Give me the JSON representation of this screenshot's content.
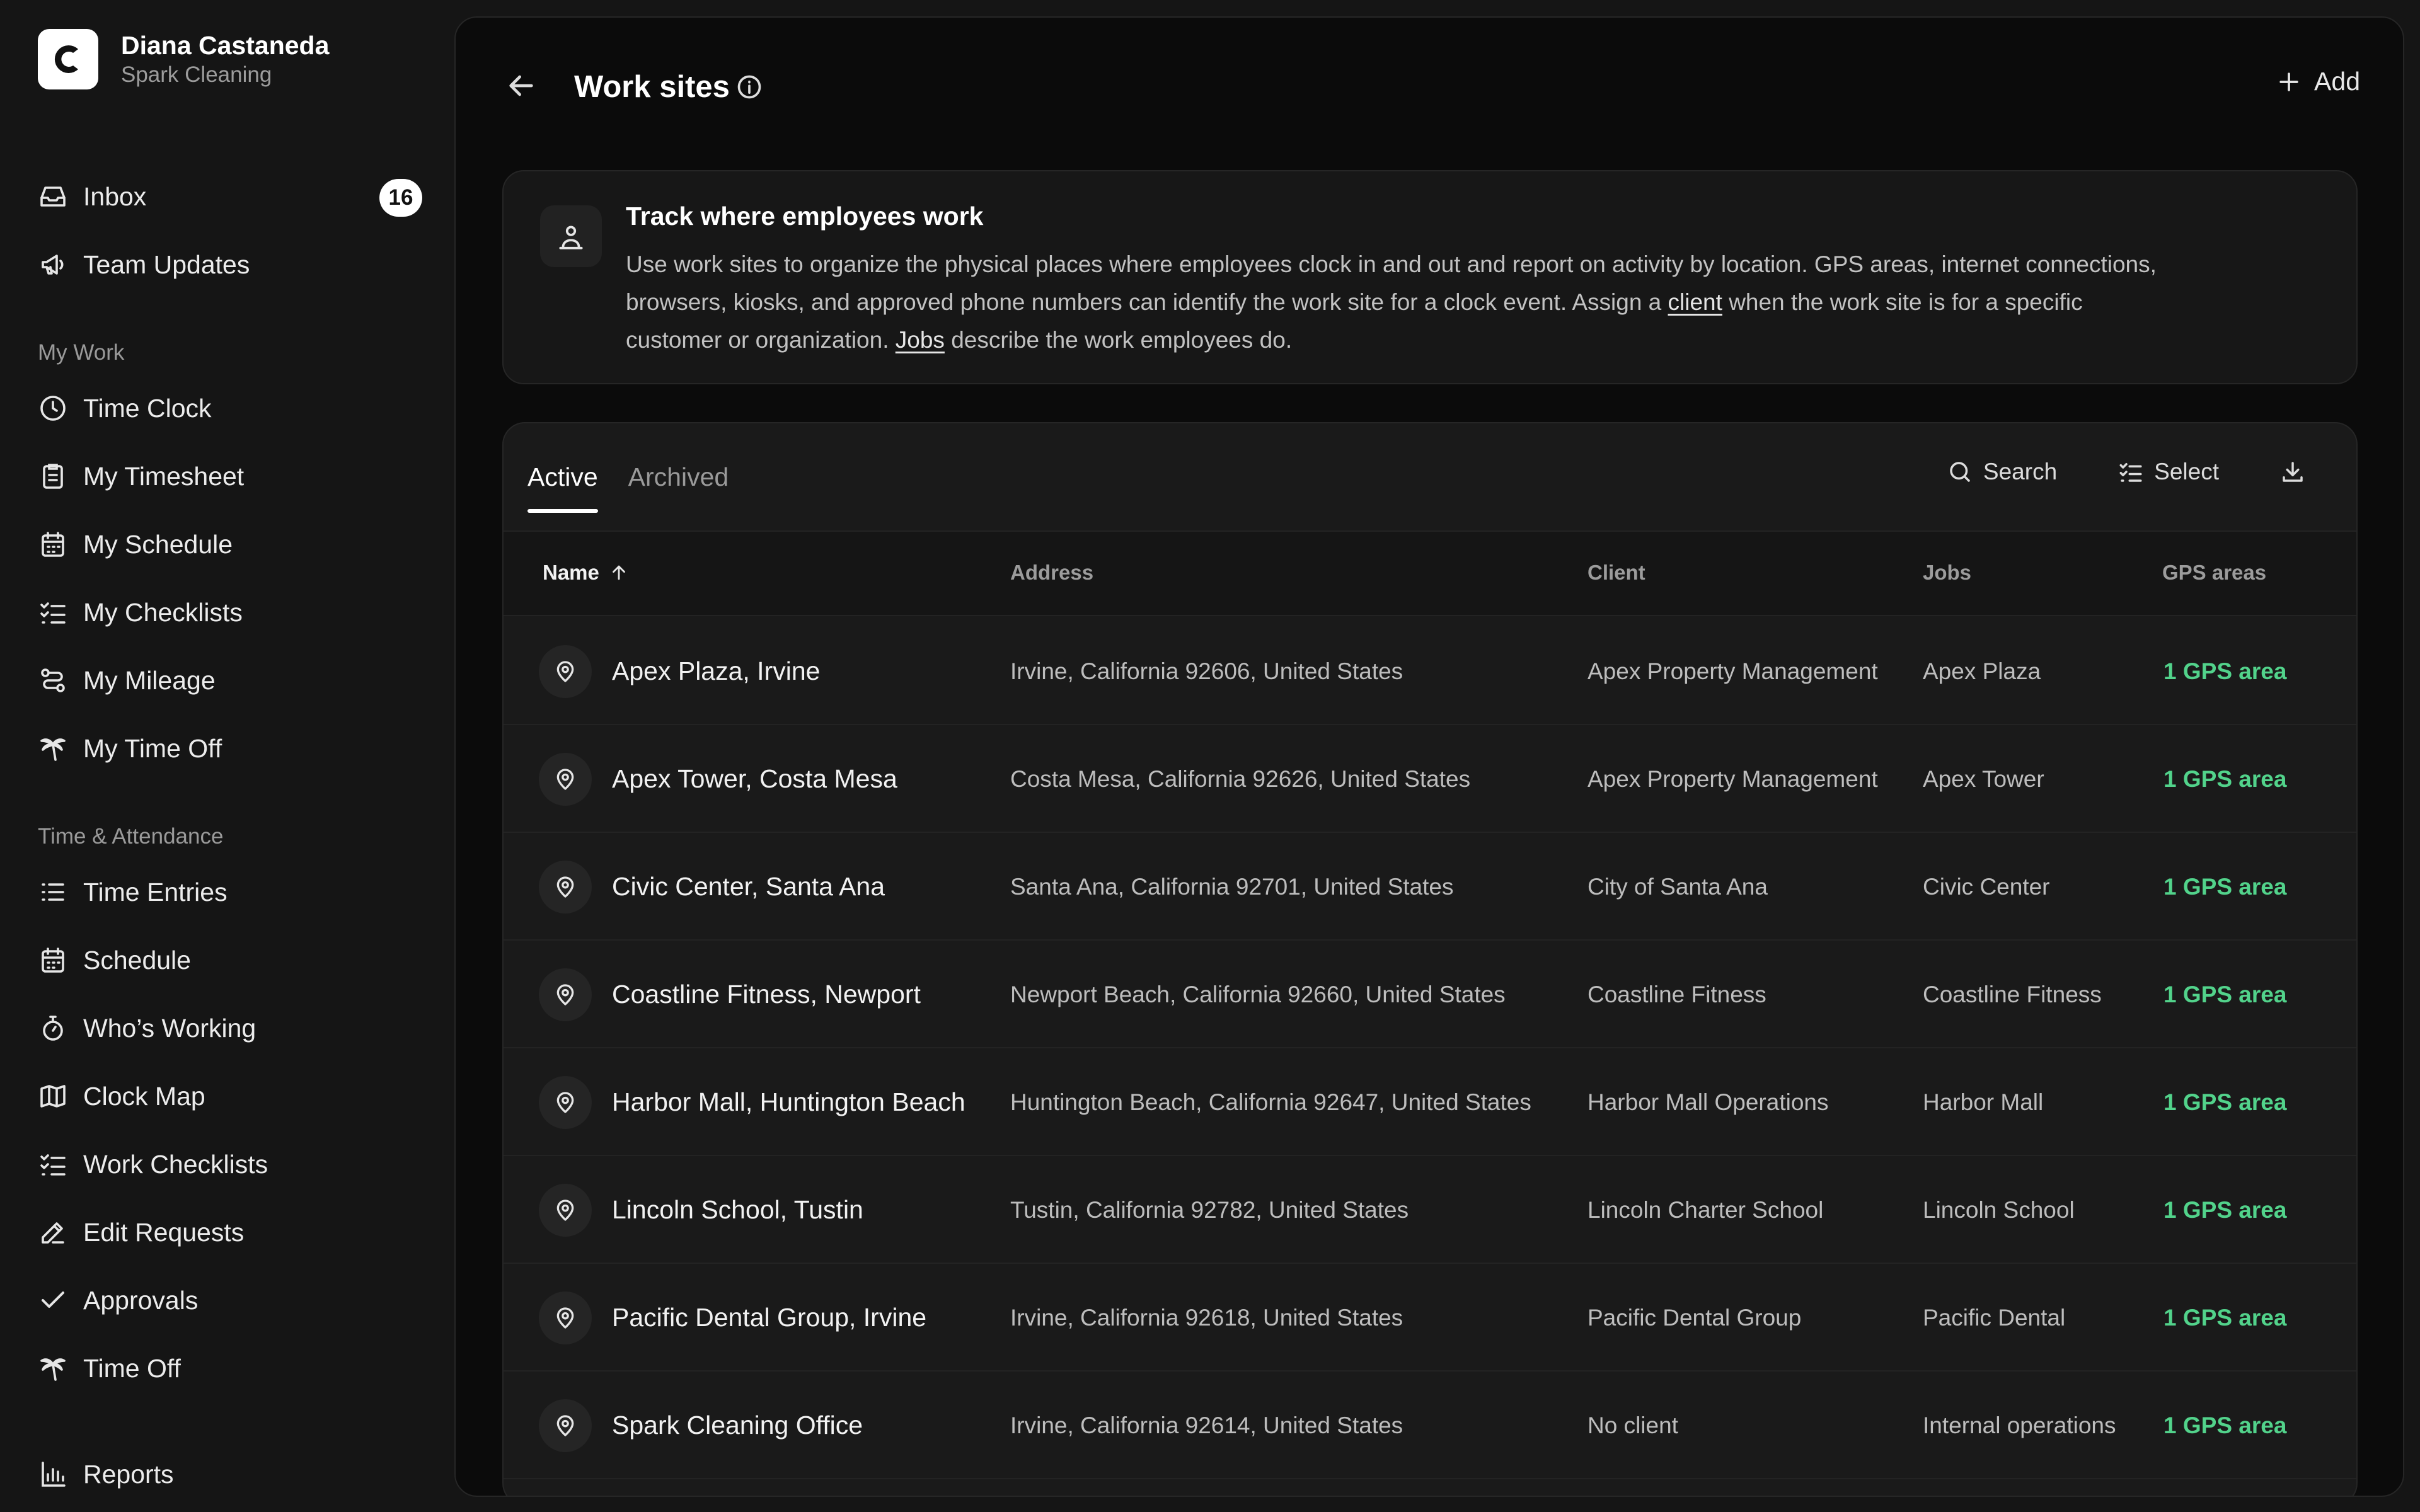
{
  "org": {
    "name": "Diana Castaneda",
    "company": "Spark Cleaning",
    "logo_letter": "C"
  },
  "sidebar": {
    "top": [
      {
        "label": "Inbox",
        "icon": "inbox-icon",
        "badge": "16"
      },
      {
        "label": "Team Updates",
        "icon": "megaphone-icon"
      }
    ],
    "section_my_work": "My Work",
    "my_work": [
      {
        "label": "Time Clock",
        "icon": "clock-icon"
      },
      {
        "label": "My Timesheet",
        "icon": "clipboard-icon"
      },
      {
        "label": "My Schedule",
        "icon": "calendar-icon"
      },
      {
        "label": "My Checklists",
        "icon": "checklist-icon"
      },
      {
        "label": "My Mileage",
        "icon": "route-icon"
      },
      {
        "label": "My Time Off",
        "icon": "palm-tree-icon"
      }
    ],
    "section_time": "Time & Attendance",
    "time": [
      {
        "label": "Time Entries",
        "icon": "list-icon"
      },
      {
        "label": "Schedule",
        "icon": "calendar-icon"
      },
      {
        "label": "Who’s Working",
        "icon": "stopwatch-icon"
      },
      {
        "label": "Clock Map",
        "icon": "map-icon"
      },
      {
        "label": "Work Checklists",
        "icon": "checklist-icon"
      },
      {
        "label": "Edit Requests",
        "icon": "pencil-icon"
      },
      {
        "label": "Approvals",
        "icon": "check-icon"
      },
      {
        "label": "Time Off",
        "icon": "palm-tree-icon"
      }
    ],
    "reports": {
      "label": "Reports",
      "icon": "bar-chart-icon"
    }
  },
  "header": {
    "title": "Work sites",
    "add_label": "Add"
  },
  "callout": {
    "title": "Track where employees work",
    "body_1": "Use work sites to organize the physical places where employees clock in and out and report on activity by location. GPS areas, internet connections, browsers, kiosks, and approved phone numbers can identify the work site for a clock event. Assign a",
    "link_client": "client",
    "body_2": "when the work site is for a specific customer or organization.",
    "link_jobs": "Jobs",
    "body_3": "describe the work employees do."
  },
  "tabs": [
    {
      "label": "Active",
      "active": true
    },
    {
      "label": "Archived",
      "active": false
    }
  ],
  "toolbar": {
    "search_label": "Search",
    "select_label": "Select"
  },
  "table": {
    "columns": {
      "name": "Name",
      "address": "Address",
      "client": "Client",
      "jobs": "Jobs",
      "gps": "GPS areas"
    },
    "rows": [
      {
        "name": "Apex Plaza, Irvine",
        "address": "Irvine, California 92606, United States",
        "client": "Apex Property Management",
        "jobs": "Apex Plaza",
        "gps": "1 GPS area"
      },
      {
        "name": "Apex Tower, Costa Mesa",
        "address": "Costa Mesa, California 92626, United States",
        "client": "Apex Property Management",
        "jobs": "Apex Tower",
        "gps": "1 GPS area"
      },
      {
        "name": "Civic Center, Santa Ana",
        "address": "Santa Ana, California 92701, United States",
        "client": "City of Santa Ana",
        "jobs": "Civic Center",
        "gps": "1 GPS area"
      },
      {
        "name": "Coastline Fitness, Newport",
        "address": "Newport Beach, California 92660, United States",
        "client": "Coastline Fitness",
        "jobs": "Coastline Fitness",
        "gps": "1 GPS area"
      },
      {
        "name": "Harbor Mall, Huntington Beach",
        "address": "Huntington Beach, California 92647, United States",
        "client": "Harbor Mall Operations",
        "jobs": "Harbor Mall",
        "gps": "1 GPS area"
      },
      {
        "name": "Lincoln School, Tustin",
        "address": "Tustin, California 92782, United States",
        "client": "Lincoln Charter School",
        "jobs": "Lincoln School",
        "gps": "1 GPS area"
      },
      {
        "name": "Pacific Dental Group, Irvine",
        "address": "Irvine, California 92618, United States",
        "client": "Pacific Dental Group",
        "jobs": "Pacific Dental",
        "gps": "1 GPS area"
      },
      {
        "name": "Spark Cleaning Office",
        "address": "Irvine, California 92614, United States",
        "client": "No client",
        "jobs": "Internal operations",
        "gps": "1 GPS area"
      }
    ]
  },
  "colors": {
    "accent_green": "#52d38b",
    "panel": "#0b0b0b",
    "card": "#1a1a1a",
    "sidebar": "#151515"
  }
}
